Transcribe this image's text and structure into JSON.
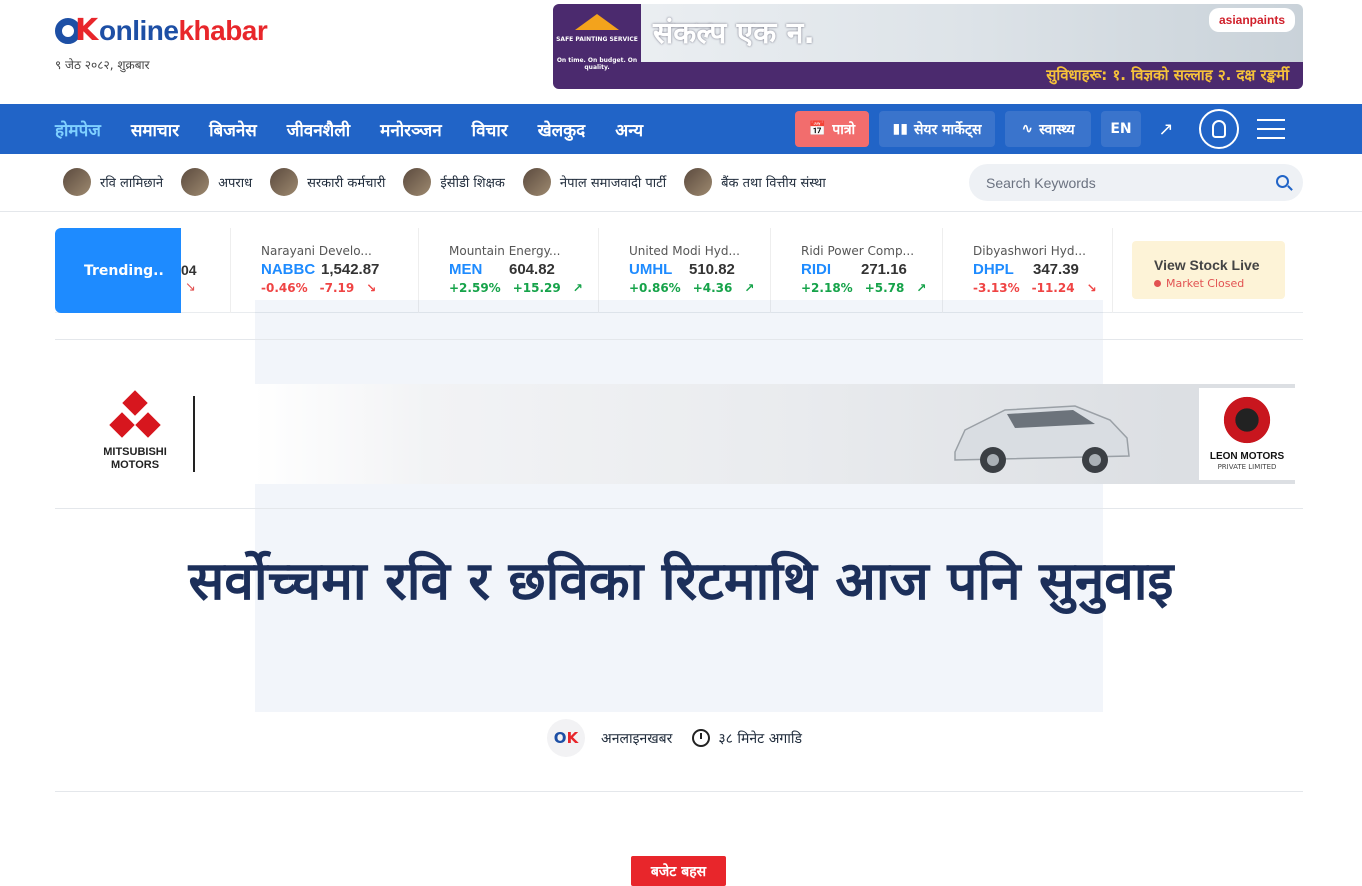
{
  "header": {
    "logo": {
      "part1": "online",
      "part2": "khabar"
    },
    "date": "९ जेठ २०८२, शुक्रबार"
  },
  "top_ad": {
    "badge_lines": [
      "SAFE PAINTING SERVICE",
      "On time. On budget. On quality."
    ],
    "title": "संकल्प एक न.",
    "brand": "asianpaints",
    "strip": "सुविधाहरू:   १. विज्ञको सल्लाह   २. दक्ष रङ्कर्मी"
  },
  "nav": {
    "items": [
      {
        "label": "होमपेज",
        "active": true
      },
      {
        "label": "समाचार"
      },
      {
        "label": "बिजनेस"
      },
      {
        "label": "जीवनशैली"
      },
      {
        "label": "मनोरञ्जन"
      },
      {
        "label": "विचार"
      },
      {
        "label": "खेलकुद"
      },
      {
        "label": "अन्य"
      }
    ],
    "patro": "पात्रो",
    "share_market": "सेयर मार्केट्स",
    "health": "स्वास्थ्य",
    "lang": "EN",
    "icons": [
      "calendar-icon",
      "candlestick-icon",
      "pulse-icon",
      "trending-icon",
      "user-icon",
      "menu-icon"
    ]
  },
  "topics": [
    {
      "label": "रवि लामिछाने"
    },
    {
      "label": "अपराध"
    },
    {
      "label": "सरकारी कर्मचारी"
    },
    {
      "label": "ईसीडी शिक्षक"
    },
    {
      "label": "नेपाल समाजवादी पार्टी"
    },
    {
      "label": "बैंक तथा वित्तीय संस्था"
    }
  ],
  "search": {
    "placeholder": "Search Keywords"
  },
  "ticker": {
    "trending_label": "Trending..",
    "partial_value": "04",
    "stocks": [
      {
        "name": "Narayani Develo...",
        "symbol": "NABBC",
        "price": "1,542.87",
        "pct": "-0.46%",
        "chg": "-7.19",
        "dir": "down"
      },
      {
        "name": "Mountain Energy...",
        "symbol": "MEN",
        "price": "604.82",
        "pct": "+2.59%",
        "chg": "+15.29",
        "dir": "up"
      },
      {
        "name": "United Modi Hyd...",
        "symbol": "UMHL",
        "price": "510.82",
        "pct": "+0.86%",
        "chg": "+4.36",
        "dir": "up"
      },
      {
        "name": "Ridi Power Comp...",
        "symbol": "RIDI",
        "price": "271.16",
        "pct": "+2.18%",
        "chg": "+5.78",
        "dir": "up"
      },
      {
        "name": "Dibyashwori Hyd...",
        "symbol": "DHPL",
        "price": "347.39",
        "pct": "-3.13%",
        "chg": "-11.24",
        "dir": "down"
      }
    ],
    "view_live": "View Stock Live",
    "market_status": "Market Closed"
  },
  "mid_ad": {
    "brand": "MITSUBISHI MOTORS",
    "dealer": "LEON MOTORS",
    "dealer_sub": "PRIVATE LIMITED"
  },
  "article": {
    "headline": "सर्वोच्चमा रवि र छविका रिटमाथि आज पनि सुनुवाइ",
    "author": "अनलाइनखबर",
    "time": "३८ मिनेट अगाडि",
    "category": "बजेट बहस"
  },
  "colors": {
    "nav_bg": "#2164c7",
    "brand_blue": "#1d4fa5",
    "brand_red": "#e8262b",
    "up": "#16a34a",
    "down": "#ef4444"
  }
}
